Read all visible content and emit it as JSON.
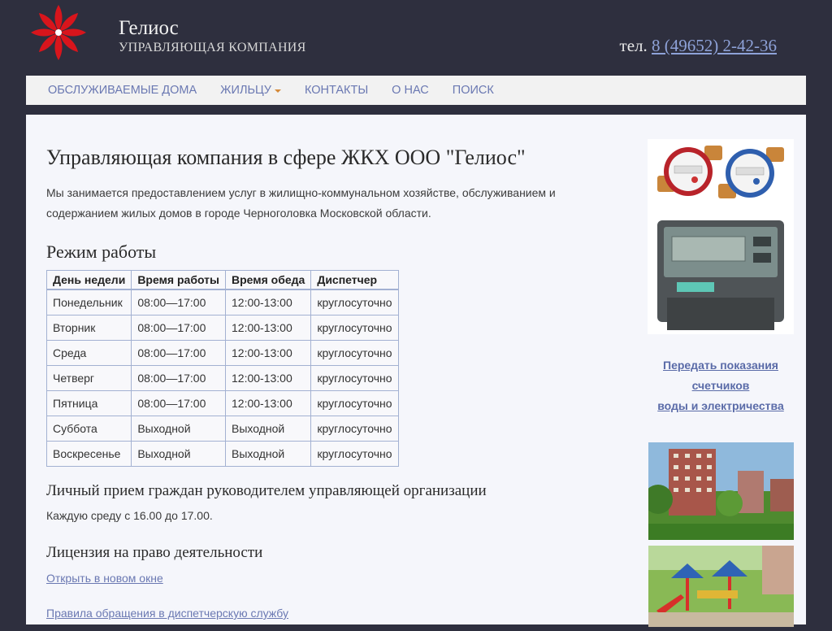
{
  "header": {
    "title": "Гелиос",
    "subtitle": "УПРАВЛЯЮЩАЯ КОМПАНИЯ",
    "phone_prefix": "тел.",
    "phone": "8 (49652) 2-42-36",
    "logo_color": "#d8151c"
  },
  "nav": {
    "items": [
      {
        "label": "ОБСЛУЖИВАЕМЫЕ ДОМА"
      },
      {
        "label": "ЖИЛЬЦУ",
        "has_dropdown": true
      },
      {
        "label": "КОНТАКТЫ"
      },
      {
        "label": "О НАС"
      },
      {
        "label": "ПОИСК"
      }
    ]
  },
  "main": {
    "title": "Управляющая компания в сфере ЖКХ ООО \"Гелиос\"",
    "intro": "Мы занимается предоставлением услуг в жилищно-коммунальном хозяйстве, обслуживанием и содержанием жилых домов в городе Черноголовка Московской области.",
    "schedule_title": "Режим работы",
    "schedule": {
      "headers": [
        "День недели",
        "Время работы",
        "Время обеда",
        "Диспетчер"
      ],
      "rows": [
        [
          "Понедельник",
          "08:00—17:00",
          "12:00-13:00",
          "круглосуточно"
        ],
        [
          "Вторник",
          "08:00—17:00",
          "12:00-13:00",
          "круглосуточно"
        ],
        [
          "Среда",
          "08:00—17:00",
          "12:00-13:00",
          "круглосуточно"
        ],
        [
          "Четверг",
          "08:00—17:00",
          "12:00-13:00",
          "круглосуточно"
        ],
        [
          "Пятница",
          "08:00—17:00",
          "12:00-13:00",
          "круглосуточно"
        ],
        [
          "Суббота",
          "Выходной",
          "Выходной",
          "круглосуточно"
        ],
        [
          "Воскресенье",
          "Выходной",
          "Выходной",
          "круглосуточно"
        ]
      ]
    },
    "reception_title": "Личный прием граждан руководителем управляющей организации",
    "reception_text": "Каждую среду с 16.00 до 17.00.",
    "license_title": "Лицензия на право деятельности",
    "open_link": "Открыть в новом окне",
    "rules_link": "Правила обращения в диспетчерскую службу"
  },
  "sidebar": {
    "meter_link_lines": [
      "Передать показания",
      "счетчиков",
      "воды и электричества"
    ]
  },
  "colors": {
    "page_bg": "#2e2f3e",
    "content_bg": "#f5f6fb",
    "link": "#6a78b2"
  }
}
